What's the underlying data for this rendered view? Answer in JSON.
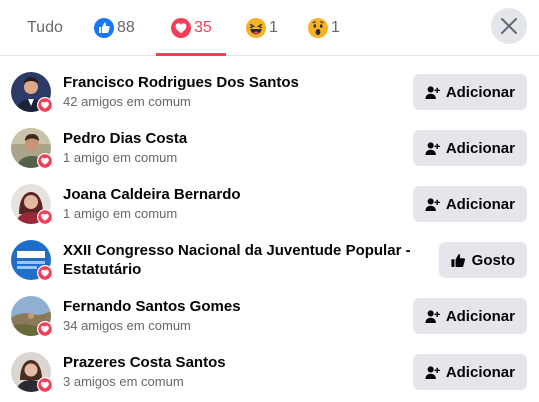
{
  "tabs": {
    "all_label": "Tudo",
    "like_count": "88",
    "love_count": "35",
    "haha_count": "1",
    "wow_count": "1"
  },
  "colors": {
    "like": "#1877f2",
    "love": "#f33e58",
    "haha": "#f7b125",
    "button_bg": "#e4e6eb",
    "secondary_text": "#65676b"
  },
  "people": [
    {
      "name": "Francisco Rodrigues Dos Santos",
      "sub": "42 amigos em comum",
      "action": "Adicionar",
      "icon": "add-friend-icon"
    },
    {
      "name": "Pedro Dias Costa",
      "sub": "1 amigo em comum",
      "action": "Adicionar",
      "icon": "add-friend-icon"
    },
    {
      "name": "Joana Caldeira Bernardo",
      "sub": "1 amigo em comum",
      "action": "Adicionar",
      "icon": "add-friend-icon"
    },
    {
      "name": "XXII Congresso Nacional da Juventude Popular - Estatutário",
      "sub": "",
      "action": "Gosto",
      "icon": "thumbs-up-icon"
    },
    {
      "name": "Fernando Santos Gomes",
      "sub": "34 amigos em comum",
      "action": "Adicionar",
      "icon": "add-friend-icon"
    },
    {
      "name": "Prazeres Costa Santos",
      "sub": "3 amigos em comum",
      "action": "Adicionar",
      "icon": "add-friend-icon"
    }
  ]
}
